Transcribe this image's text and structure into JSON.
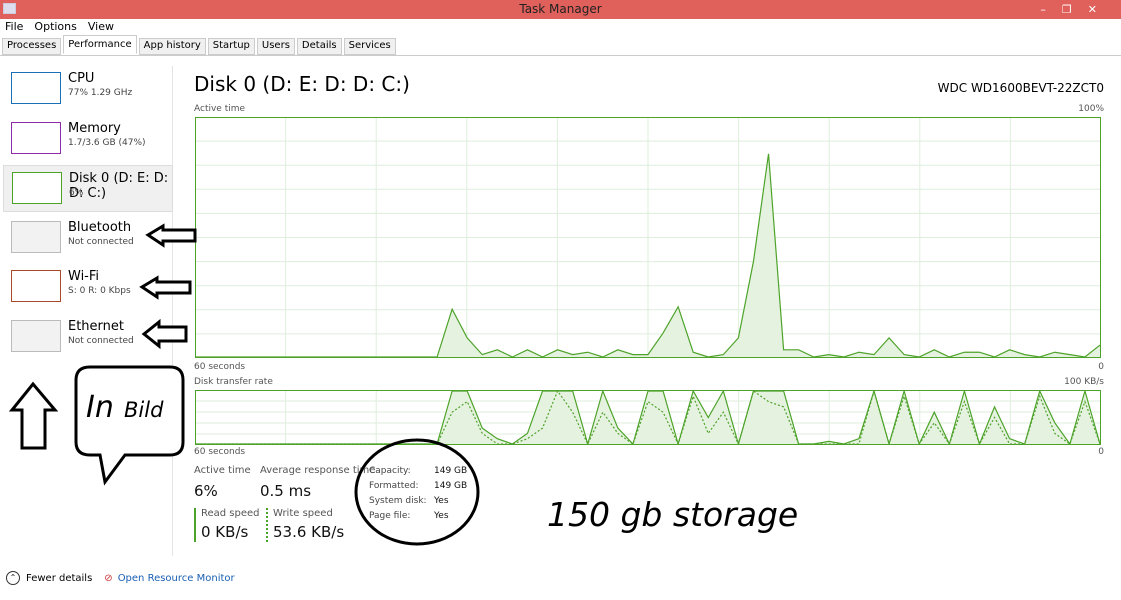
{
  "window": {
    "title": "Task Manager",
    "controls": [
      "–",
      "❐",
      "✕"
    ]
  },
  "menu": [
    "File",
    "Options",
    "View"
  ],
  "tabs": [
    "Processes",
    "Performance",
    "App history",
    "Startup",
    "Users",
    "Details",
    "Services"
  ],
  "active_tab": "Performance",
  "sidebar": [
    {
      "name": "CPU",
      "sub": "77% 1.29 GHz",
      "color": "#1a6fb5"
    },
    {
      "name": "Memory",
      "sub": "1.7/3.6 GB (47%)",
      "color": "#8b2ca8"
    },
    {
      "name": "Disk 0 (D: E: D: D: C:)",
      "sub": "6%",
      "color": "#4da32a"
    },
    {
      "name": "Bluetooth",
      "sub": "Not connected",
      "color": "#bbbbbb"
    },
    {
      "name": "Wi-Fi",
      "sub": "S: 0 R: 0 Kbps",
      "color": "#a84a2a"
    },
    {
      "name": "Ethernet",
      "sub": "Not connected",
      "color": "#bbbbbb"
    }
  ],
  "main": {
    "title": "Disk 0 (D: E: D: D: C:)",
    "model": "WDC WD1600BEVT-22ZCT0",
    "chart1": {
      "label": "Active time",
      "max": "100%",
      "xleft": "60 seconds",
      "xright": "0"
    },
    "chart2": {
      "label": "Disk transfer rate",
      "max": "100 KB/s",
      "xleft": "60 seconds",
      "xright": "0"
    },
    "stats": {
      "active_time_label": "Active time",
      "active_time": "6%",
      "avg_label": "Average response time",
      "avg": "0.5 ms",
      "read_label": "Read speed",
      "read": "0 KB/s",
      "write_label": "Write speed",
      "write": "53.6 KB/s"
    },
    "info": [
      [
        "Capacity:",
        "149 GB"
      ],
      [
        "Formatted:",
        "149 GB"
      ],
      [
        "System disk:",
        "Yes"
      ],
      [
        "Page file:",
        "Yes"
      ]
    ]
  },
  "chart_data": [
    {
      "type": "area",
      "title": "Active time",
      "ylim": [
        0,
        100
      ],
      "x_range_seconds": [
        60,
        0
      ],
      "values": [
        0,
        0,
        0,
        0,
        0,
        0,
        0,
        0,
        0,
        0,
        0,
        0,
        0,
        0,
        0,
        0,
        0,
        20,
        8,
        1,
        3,
        0,
        3,
        0,
        3,
        1,
        2,
        0,
        3,
        1,
        1,
        10,
        21,
        2,
        0,
        1,
        8,
        40,
        85,
        3,
        3,
        0,
        1,
        0,
        2,
        1,
        8,
        1,
        0,
        3,
        0,
        2,
        2,
        0,
        3,
        1,
        0,
        2,
        1,
        0,
        5
      ]
    },
    {
      "type": "area",
      "title": "Disk transfer rate",
      "ylim": [
        0,
        100
      ],
      "x_range_seconds": [
        60,
        0
      ],
      "series": [
        {
          "values": [
            0,
            0,
            0,
            0,
            0,
            0,
            0,
            0,
            0,
            0,
            0,
            0,
            0,
            0,
            0,
            0,
            0,
            100,
            100,
            30,
            10,
            0,
            20,
            100,
            100,
            100,
            0,
            100,
            30,
            0,
            100,
            100,
            0,
            100,
            50,
            100,
            0,
            100,
            100,
            100,
            0,
            0,
            5,
            0,
            10,
            100,
            0,
            100,
            0,
            60,
            0,
            100,
            0,
            70,
            10,
            0,
            100,
            40,
            0,
            100,
            0
          ]
        },
        {
          "values": [
            0,
            0,
            0,
            0,
            0,
            0,
            0,
            0,
            0,
            0,
            0,
            0,
            0,
            0,
            0,
            0,
            0,
            60,
            80,
            20,
            0,
            0,
            10,
            30,
            100,
            60,
            0,
            60,
            20,
            0,
            80,
            60,
            0,
            90,
            20,
            60,
            0,
            100,
            80,
            70,
            0,
            0,
            0,
            0,
            0,
            100,
            0,
            90,
            0,
            40,
            0,
            80,
            0,
            50,
            0,
            0,
            90,
            20,
            0,
            80,
            0
          ]
        }
      ]
    }
  ],
  "annotations": {
    "in_bild_1": "In",
    "in_bild_2": "Bild",
    "storage": "150 gb storage"
  },
  "footer": {
    "fewer": "Fewer details",
    "monitor": "Open Resource Monitor"
  }
}
